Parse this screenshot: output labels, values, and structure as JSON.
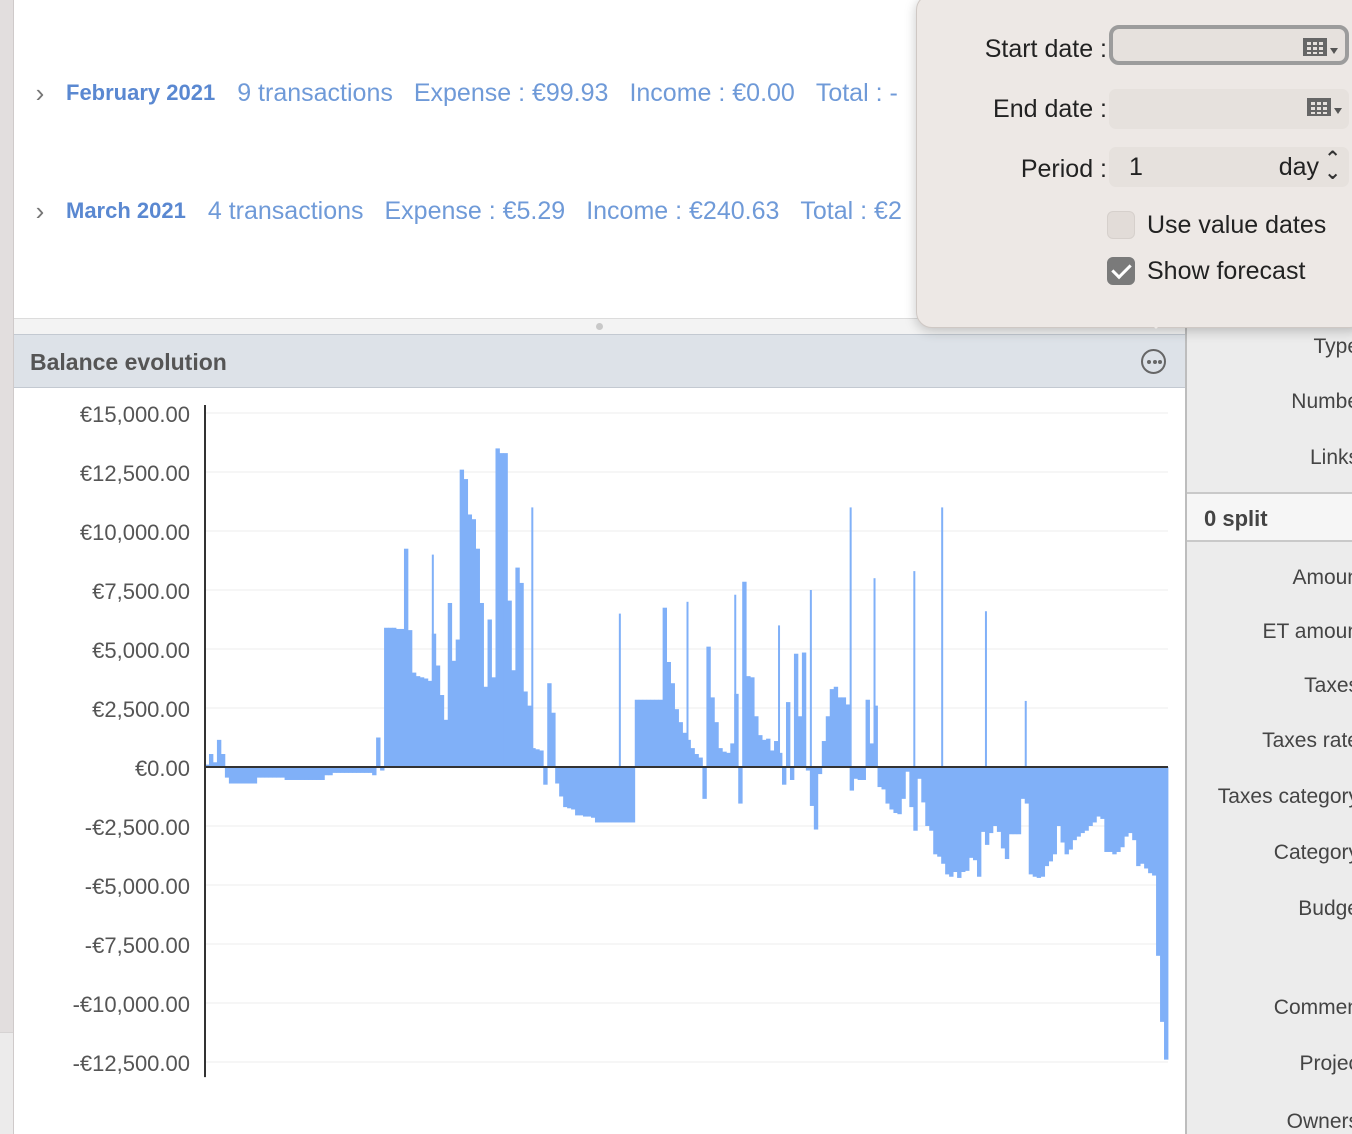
{
  "months": [
    {
      "name": "February 2021",
      "transactions": "9 transactions",
      "expense": "Expense : €99.93",
      "income": "Income : €0.00",
      "total": "Total : -"
    },
    {
      "name": "March 2021",
      "transactions": "4 transactions",
      "expense": "Expense : €5.29",
      "income": "Income : €240.63",
      "total": "Total : €2"
    }
  ],
  "chart_panel": {
    "title": "Balance evolution"
  },
  "popover": {
    "start_date_label": "Start date :",
    "start_date_value": "",
    "end_date_label": "End date :",
    "end_date_value": "",
    "period_label": "Period :",
    "period_value": "1",
    "period_unit": "day",
    "use_value_dates_label": "Use value dates",
    "use_value_dates_checked": false,
    "show_forecast_label": "Show forecast",
    "show_forecast_checked": true
  },
  "right_panel": {
    "fields": [
      "Type",
      "Numbe",
      "Links"
    ],
    "split_label": "0 split",
    "split_fields": [
      "Amoun",
      "ET amoun",
      "Taxes",
      "Taxes rate",
      "Taxes category",
      "Category",
      "Budge",
      "Commen",
      "Projec",
      "Owners"
    ]
  },
  "colors": {
    "bar": "#80b0f8",
    "link": "#6f9ad8",
    "axis": "#333333"
  },
  "chart_data": {
    "type": "bar",
    "title": "Balance evolution",
    "y_ticks": [
      "€15,000.00",
      "€12,500.00",
      "€10,000.00",
      "€7,500.00",
      "€5,000.00",
      "€2,500.00",
      "€0.00",
      "-€2,500.00",
      "-€5,000.00",
      "-€7,500.00",
      "-€10,000.00",
      "-€12,500.00"
    ],
    "ylim": [
      -12800,
      15000
    ],
    "grid": true,
    "series": [
      {
        "values": [
          100,
          550,
          200,
          1150,
          550,
          -450,
          -700,
          -700,
          -700,
          -700,
          -700,
          -700,
          -700,
          -450,
          -450,
          -450,
          -450,
          -450,
          -450,
          -450,
          -550,
          -550,
          -550,
          -550,
          -550,
          -550,
          -550,
          -550,
          -550,
          -550,
          -350,
          -350,
          -250,
          -250,
          -250,
          -250,
          -250,
          -250,
          -250,
          -250,
          -250,
          -250,
          -350,
          1250,
          -150,
          5900,
          5900,
          5900,
          5850,
          5850,
          9250,
          5800,
          4000,
          3850,
          3800,
          3750,
          3650,
          5650,
          4300,
          3050,
          2000,
          6950,
          4500,
          5400,
          12600,
          12200,
          10700,
          10500,
          9250,
          6950,
          3400,
          6250,
          3800,
          13500,
          13300,
          13300,
          7050,
          4100,
          8450,
          7800,
          3200,
          2600,
          800,
          750,
          700,
          -750,
          3550,
          2300,
          -700,
          -1250,
          -1700,
          -1750,
          -1800,
          -2050,
          -2050,
          -2100,
          -2100,
          -2150,
          -2350,
          -2350,
          -2350,
          -2350,
          -2350,
          -2350,
          -2350,
          -2350,
          -2350,
          -2350,
          2850,
          2850,
          2850,
          2850,
          2850,
          2850,
          2850,
          6750,
          4450,
          3550,
          2450,
          1900,
          1450,
          1150,
          800,
          550,
          400,
          -1350,
          5100,
          2950,
          1900,
          800,
          650,
          600,
          1000,
          3100,
          -1550,
          7850,
          3850,
          3800,
          2150,
          1350,
          1150,
          1200,
          700,
          1100,
          600,
          -750,
          2750,
          -550,
          4800,
          2150,
          4850,
          -150,
          -1650,
          -2650,
          -300,
          1100,
          2150,
          3300,
          3400,
          2950,
          2950,
          2650,
          -1000,
          -500,
          -550,
          -550,
          2850,
          1000,
          2600,
          -850,
          -950,
          -1550,
          -1800,
          -1950,
          -2000,
          -1350,
          -200,
          -1700,
          -2700,
          -500,
          -1500,
          -2500,
          -2700,
          -3700,
          -3800,
          -4100,
          -4550,
          -4650,
          -4450,
          -4700,
          -4450,
          -4400,
          -3850,
          -3950,
          -4650,
          -2750,
          -3300,
          -2800,
          -2500,
          -2750,
          -3450,
          -3900,
          -2850,
          -2850,
          -2850,
          -1350,
          -1550,
          -4550,
          -4650,
          -4700,
          -4650,
          -4200,
          -4000,
          -3700,
          -2500,
          -3200,
          -3700,
          -3500,
          -3100,
          -2950,
          -2800,
          -2700,
          -2500,
          -2350,
          -2100,
          -2200,
          -3600,
          -3600,
          -3700,
          -3600,
          -3400,
          -2950,
          -2800,
          -3100,
          -4200,
          -4100,
          -4300,
          -4500,
          -4600,
          -8000,
          -10800,
          -12400
        ]
      }
    ],
    "spikes": [
      {
        "index": 57,
        "value": 9000
      },
      {
        "index": 75,
        "value": 10800
      },
      {
        "index": 82,
        "value": 11000
      },
      {
        "index": 104,
        "value": 6500
      },
      {
        "index": 121,
        "value": 7000
      },
      {
        "index": 133,
        "value": 7300
      },
      {
        "index": 144,
        "value": 6000
      },
      {
        "index": 152,
        "value": 7500
      },
      {
        "index": 162,
        "value": 11000
      },
      {
        "index": 168,
        "value": 8000
      },
      {
        "index": 178,
        "value": 8300
      },
      {
        "index": 185,
        "value": 11000
      },
      {
        "index": 196,
        "value": 6600
      },
      {
        "index": 206,
        "value": 2800
      }
    ]
  }
}
